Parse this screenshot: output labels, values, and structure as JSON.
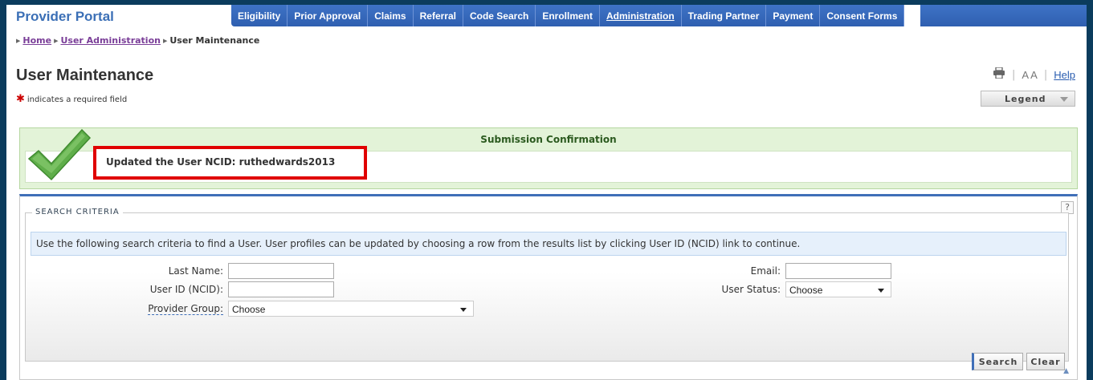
{
  "header": {
    "logo": "Provider Portal",
    "nav": [
      {
        "label": "Eligibility"
      },
      {
        "label": "Prior Approval"
      },
      {
        "label": "Claims"
      },
      {
        "label": "Referral"
      },
      {
        "label": "Code Search"
      },
      {
        "label": "Enrollment"
      },
      {
        "label": "Administration"
      },
      {
        "label": "Trading Partner"
      },
      {
        "label": "Payment"
      },
      {
        "label": "Consent Forms"
      }
    ],
    "breadcrumb": {
      "home": "Home",
      "admin": "User Administration",
      "current": "User Maintenance"
    }
  },
  "page": {
    "title": "User Maintenance",
    "required_symbol": "✱",
    "required_note": "indicates a required field",
    "font_size_label": "A A",
    "help": "Help",
    "legend": "Legend"
  },
  "confirmation": {
    "title": "Submission Confirmation",
    "message": "Updated the User NCID: ruthedwards2013"
  },
  "search": {
    "legend": "SEARCH CRITERIA",
    "help_mark": "?",
    "info": "Use the following search criteria to find a User. User profiles can be updated by choosing a row from the results list by clicking User ID (NCID) link to continue.",
    "last_name_label": "Last Name:",
    "last_name_value": "",
    "user_id_label": "User ID (NCID):",
    "user_id_value": "",
    "provider_group_label": "Provider Group:",
    "provider_group_value": "Choose",
    "email_label": "Email:",
    "email_value": "",
    "user_status_label": "User Status:",
    "user_status_value": "Choose",
    "search_button": "Search",
    "clear_button": "Clear"
  },
  "colors": {
    "accent": "#3f6fb8",
    "success_bg": "#e3f3d8",
    "highlight": "#e00000"
  }
}
